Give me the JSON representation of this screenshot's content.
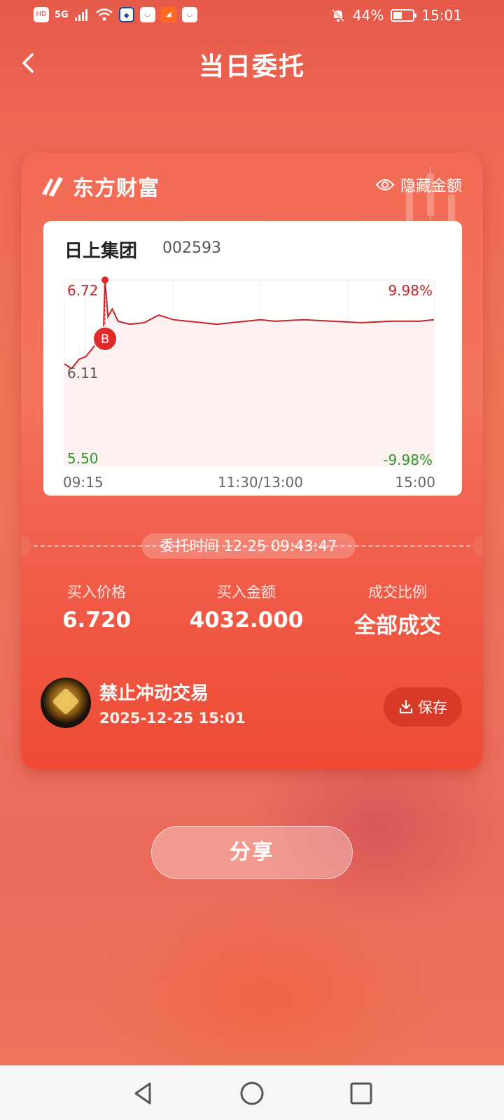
{
  "status_bar": {
    "hd": "HD",
    "network": "5G",
    "battery_percent": "44%",
    "battery_level": 0.44,
    "time": "15:01",
    "icons": [
      "hd-icon",
      "signal-5g-icon",
      "wifi-icon",
      "bank-app-icon",
      "app-icon",
      "eastmoney-app-icon",
      "app-icon",
      "mute-bell-icon",
      "battery-icon"
    ]
  },
  "header": {
    "title": "当日委托",
    "back_icon": "chevron-left-icon"
  },
  "card": {
    "brand": "东方财富",
    "hide_amount_label": "隐藏金额",
    "hide_amount_icon": "eye-icon",
    "stock": {
      "name": "日上集团",
      "code": "002593"
    },
    "entrust_time": "委托时间 12-25 09:43:47",
    "stats": [
      {
        "label": "买入价格",
        "value": "6.720"
      },
      {
        "label": "买入金额",
        "value": "4032.000"
      },
      {
        "label": "成交比例",
        "value": "全部成交"
      }
    ],
    "motto": "禁止冲动交易",
    "timestamp": "2025-12-25 15:01",
    "save_label": "保存",
    "save_icon": "download-icon"
  },
  "share_label": "分享",
  "nav": {
    "back_icon": "triangle-back-icon",
    "home_icon": "circle-home-icon",
    "recent_icon": "square-recent-icon"
  },
  "colors": {
    "accent": "#e8443a",
    "line": "#c8252b",
    "up": "#c8252b",
    "down": "#2a9a2a",
    "card_bg": "#f26a55"
  },
  "chart_data": {
    "type": "line",
    "y_top_label": "6.72",
    "y_mid_label": "6.11",
    "y_bottom_label": "5.50",
    "pct_top_label": "9.98%",
    "pct_bottom_label": "-9.98%",
    "x_labels": [
      "09:15",
      "11:30/13:00",
      "15:00"
    ],
    "ylim": [
      5.5,
      6.72
    ],
    "buy_marker": {
      "label": "B",
      "x": "09:43",
      "y": 6.72
    },
    "x": [
      "09:15",
      "09:20",
      "09:25",
      "09:30",
      "09:35",
      "09:38",
      "09:40",
      "09:42",
      "09:43",
      "09:45",
      "09:48",
      "09:52",
      "10:00",
      "10:10",
      "10:20",
      "10:30",
      "10:40",
      "10:50",
      "11:00",
      "11:10",
      "11:20",
      "11:30",
      "13:10",
      "13:30",
      "13:50",
      "14:10",
      "14:30",
      "14:50",
      "15:00"
    ],
    "values": [
      6.17,
      6.14,
      6.2,
      6.22,
      6.28,
      6.33,
      6.36,
      6.41,
      6.72,
      6.48,
      6.53,
      6.45,
      6.43,
      6.44,
      6.49,
      6.46,
      6.45,
      6.44,
      6.43,
      6.44,
      6.45,
      6.46,
      6.45,
      6.46,
      6.45,
      6.44,
      6.45,
      6.45,
      6.46
    ]
  }
}
